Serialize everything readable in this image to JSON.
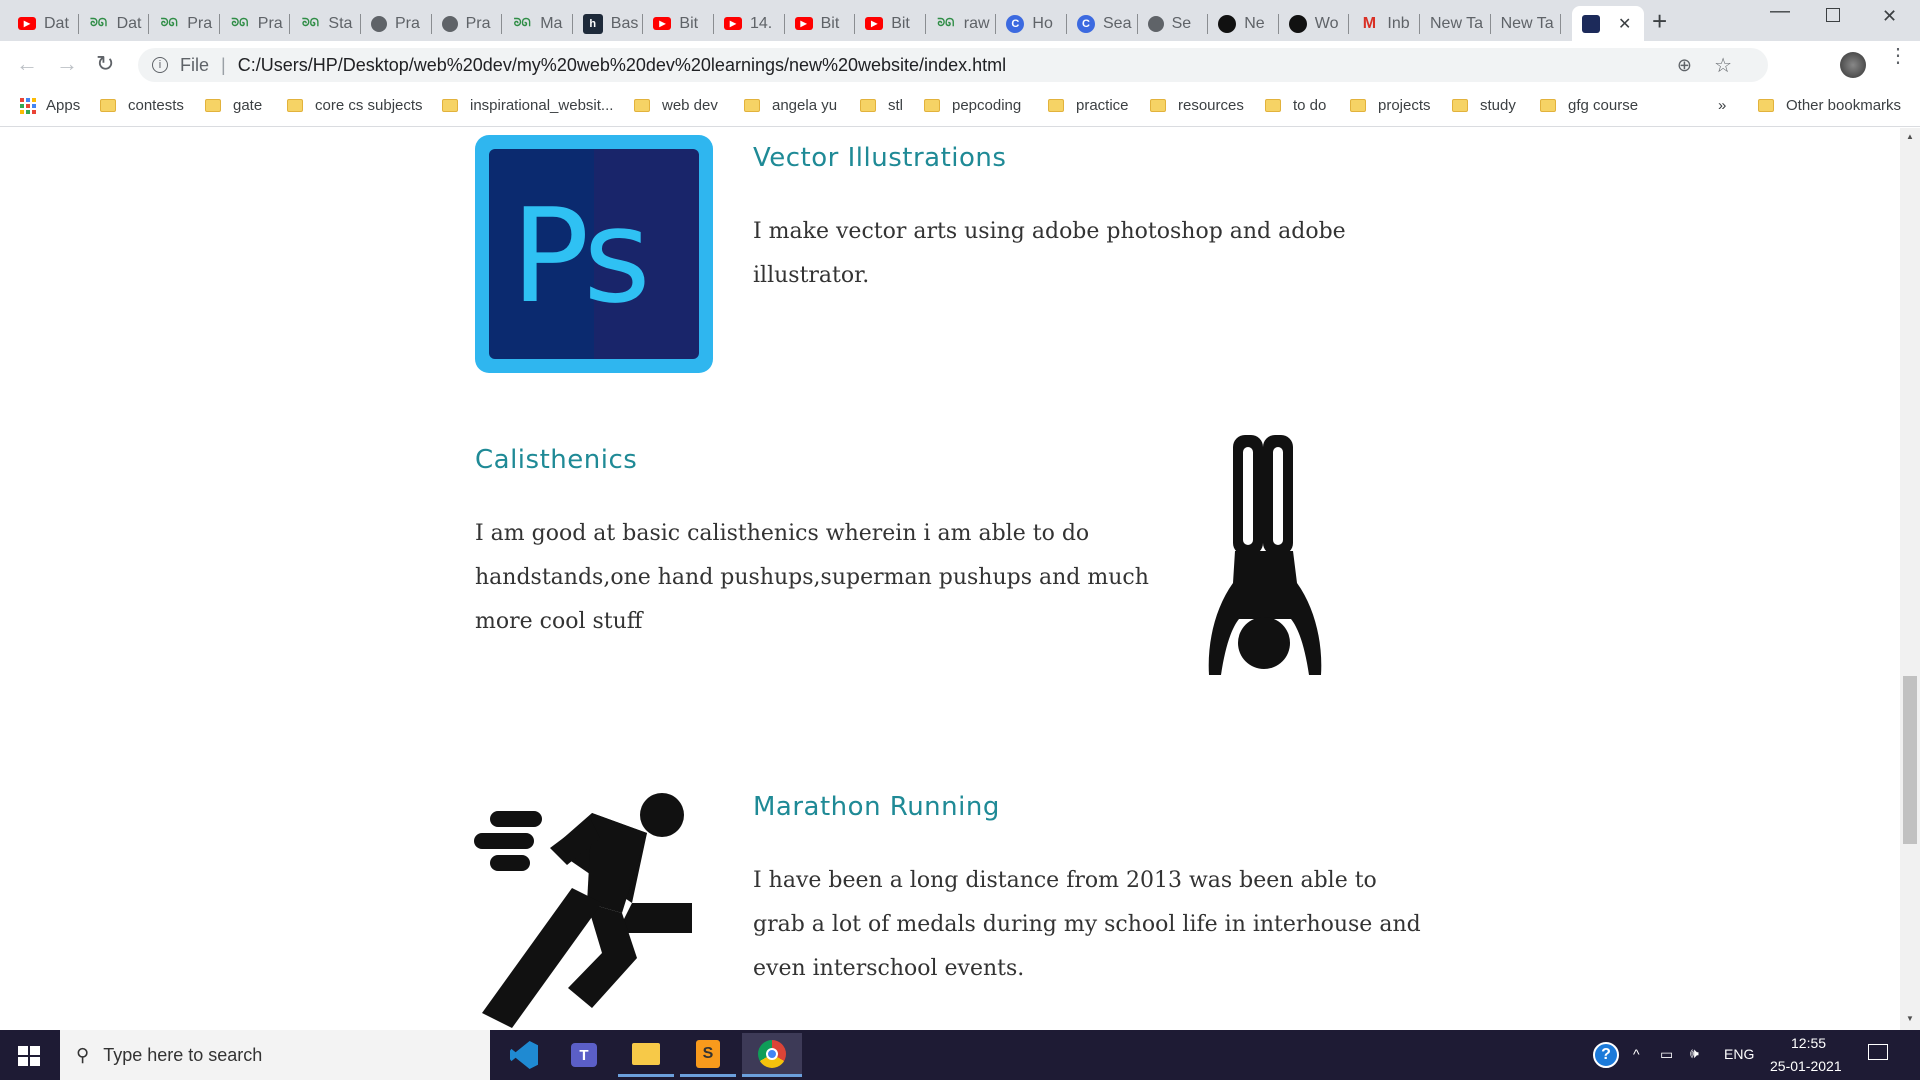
{
  "tabs": [
    {
      "label": "Dat",
      "icon": "youtube-icon",
      "color": "#ff0000"
    },
    {
      "label": "Dat",
      "icon": "gfg-icon",
      "color": "#2f8d46"
    },
    {
      "label": "Pra",
      "icon": "gfg-icon",
      "color": "#2f8d46"
    },
    {
      "label": "Pra",
      "icon": "gfg-icon",
      "color": "#2f8d46"
    },
    {
      "label": "Sta",
      "icon": "gfg-icon",
      "color": "#2f8d46"
    },
    {
      "label": "Pra",
      "icon": "globe-icon",
      "color": "#5f6368"
    },
    {
      "label": "Pra",
      "icon": "globe-icon",
      "color": "#5f6368"
    },
    {
      "label": "Ma",
      "icon": "gfg-icon",
      "color": "#2f8d46"
    },
    {
      "label": "Bas",
      "icon": "hackerrank-icon",
      "color": "#1e2a3a"
    },
    {
      "label": "Bit",
      "icon": "youtube-icon",
      "color": "#ff0000"
    },
    {
      "label": "14.",
      "icon": "youtube-icon",
      "color": "#ff0000"
    },
    {
      "label": "Bit",
      "icon": "youtube-icon",
      "color": "#ff0000"
    },
    {
      "label": "Bit",
      "icon": "youtube-icon",
      "color": "#ff0000"
    },
    {
      "label": "raw",
      "icon": "gfg-icon",
      "color": "#2f8d46"
    },
    {
      "label": "Ho",
      "icon": "c-circle-icon",
      "color": "#3c6ae0"
    },
    {
      "label": "Sea",
      "icon": "c-circle-icon",
      "color": "#3c6ae0"
    },
    {
      "label": "Se",
      "icon": "globe-icon",
      "color": "#5f6368"
    },
    {
      "label": "Ne",
      "icon": "github-icon",
      "color": "#111111"
    },
    {
      "label": "Wo",
      "icon": "github-icon",
      "color": "#111111"
    },
    {
      "label": "Inb",
      "icon": "gmail-icon",
      "color": "#d93025"
    },
    {
      "label": "New Ta",
      "icon": "",
      "color": ""
    },
    {
      "label": "New Ta",
      "icon": "",
      "color": ""
    }
  ],
  "active_tab": {
    "icon": "profile-photo-icon"
  },
  "address": {
    "scheme_label": "File",
    "url": "C:/Users/HP/Desktop/web%20dev/my%20web%20dev%20learnings/new%20website/index.html"
  },
  "bookmarks": {
    "apps_label": "Apps",
    "items": [
      "contests",
      "gate",
      "core cs subjects",
      "inspirational_websit...",
      "web dev",
      "angela yu",
      "stl",
      "pepcoding",
      "practice",
      "resources",
      "to do",
      "projects",
      "study",
      "gfg course"
    ],
    "overflow": "»",
    "other": "Other bookmarks"
  },
  "sections": {
    "vector": {
      "title": "Vector Illustrations",
      "text": "I make vector arts using adobe photoshop and adobe illustrator.",
      "logo_text": "Ps"
    },
    "calisthenics": {
      "title": "Calisthenics",
      "text": "I am good at basic calisthenics wherein i am able to do handstands,one hand pushups,superman pushups and much more cool stuff"
    },
    "marathon": {
      "title": "Marathon Running",
      "text": "I have been a long distance from 2013 was been able to grab a lot of medals during my school life in interhouse and even interschool events."
    }
  },
  "taskbar": {
    "search_placeholder": "Type here to search",
    "lang": "ENG",
    "time": "12:55",
    "date": "25-01-2021"
  },
  "colors": {
    "accent": "#1f8a96",
    "ps_dark": "#0b2a6f",
    "ps_light": "#2fb6ef"
  }
}
